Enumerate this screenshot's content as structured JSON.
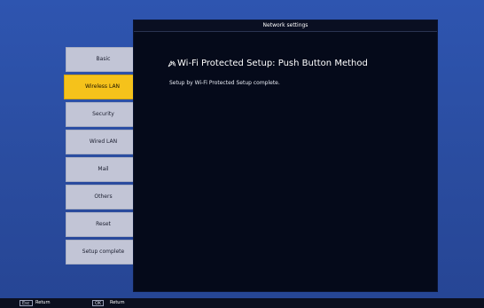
{
  "panel": {
    "title": "Network settings",
    "heading": "Wi-Fi Protected Setup: Push Button Method",
    "heading_icon": "wifi-push-icon",
    "message": "Setup by Wi-Fi Protected Setup complete."
  },
  "sidebar": {
    "items": [
      {
        "label": "Basic"
      },
      {
        "label": "Wireless LAN"
      },
      {
        "label": "Security"
      },
      {
        "label": "Wired LAN"
      },
      {
        "label": "Mail"
      },
      {
        "label": "Others"
      },
      {
        "label": "Reset"
      },
      {
        "label": "Setup complete"
      }
    ],
    "active_index": 1
  },
  "footer": {
    "key1": "Esc",
    "label1": "Return",
    "key2": "OK",
    "label2": "Return"
  },
  "colors": {
    "background": "#2b4fa3",
    "panel": "#050a1a",
    "active_tab": "#f5c21b",
    "inactive_tab": "#c2c5d6"
  }
}
